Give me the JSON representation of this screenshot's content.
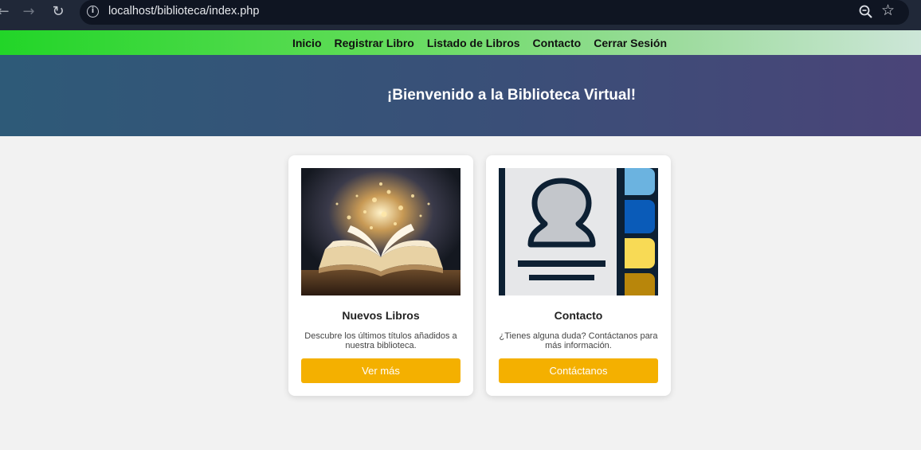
{
  "browser": {
    "url": "localhost/biblioteca/index.php"
  },
  "nav": {
    "items": [
      "Inicio",
      "Registrar Libro",
      "Listado de Libros",
      "Contacto",
      "Cerrar Sesión"
    ]
  },
  "hero": {
    "title": "¡Bienvenido a la Biblioteca Virtual!"
  },
  "cards": [
    {
      "title": "Nuevos Libros",
      "description": "Descubre los últimos títulos añadidos a nuestra biblioteca.",
      "button": "Ver más",
      "image_icon": "open-book-image"
    },
    {
      "title": "Contacto",
      "description": "¿Tienes alguna duda? Contáctanos para más información.",
      "button": "Contáctanos",
      "image_icon": "contact-book-image"
    }
  ],
  "colors": {
    "accent_button": "#f4b000",
    "hero_start": "#2e5a78",
    "hero_end": "#4a4478",
    "nav_start": "#22d528"
  }
}
